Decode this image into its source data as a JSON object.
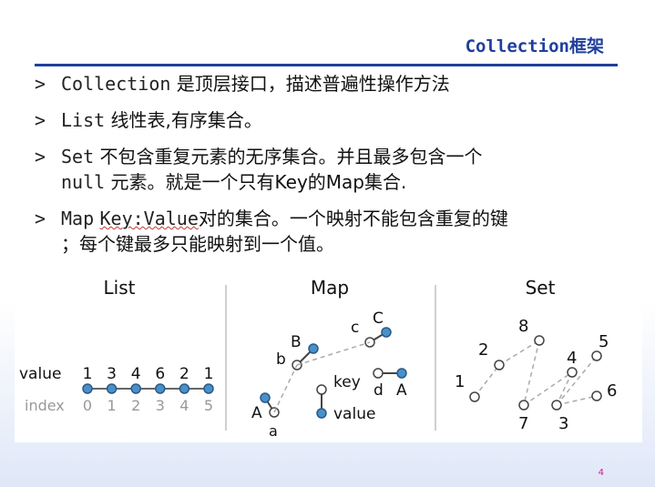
{
  "slide": {
    "title_code": "Collection",
    "title_cjk": "框架",
    "page_number": "4"
  },
  "bullets": [
    {
      "mark": ">",
      "code": "Collection",
      "text": " 是顶层接口，描述普遍性操作方法"
    },
    {
      "mark": ">",
      "code": "List",
      "text": " 线性表,有序集合。"
    },
    {
      "mark": ">",
      "code": "Set",
      "text": " 不包含重复元素的无序集合。并且最多包含一个",
      "code2": "null",
      "text2": " 元素。就是一个只有Key的Map集合."
    },
    {
      "mark": ">",
      "code": "Map",
      "code_key": "Key:Value",
      "text": "对的集合。一个映射不能包含重复的键",
      "text2": "；每个键最多只能映射到一个值。"
    }
  ],
  "diagram": {
    "list": {
      "heading": "List",
      "value_label": "value",
      "index_label": "index",
      "values": [
        "1",
        "3",
        "4",
        "6",
        "2",
        "1"
      ],
      "indices": [
        "0",
        "1",
        "2",
        "3",
        "4",
        "5"
      ]
    },
    "map": {
      "heading": "Map",
      "pairs": [
        {
          "key": "a",
          "value": "A"
        },
        {
          "key": "b",
          "value": "B"
        },
        {
          "key": "c",
          "value": "C"
        },
        {
          "key": "d",
          "value": "A"
        }
      ],
      "legend_key": "key",
      "legend_value": "value"
    },
    "set": {
      "heading": "Set",
      "elements": [
        "8",
        "2",
        "4",
        "5",
        "1",
        "6",
        "7",
        "3"
      ]
    },
    "colors": {
      "node_fill": "#4a90c8",
      "node_stroke": "#2a5a86",
      "line": "#aaaaaa",
      "text": "#111111",
      "index_text": "#999999"
    }
  }
}
